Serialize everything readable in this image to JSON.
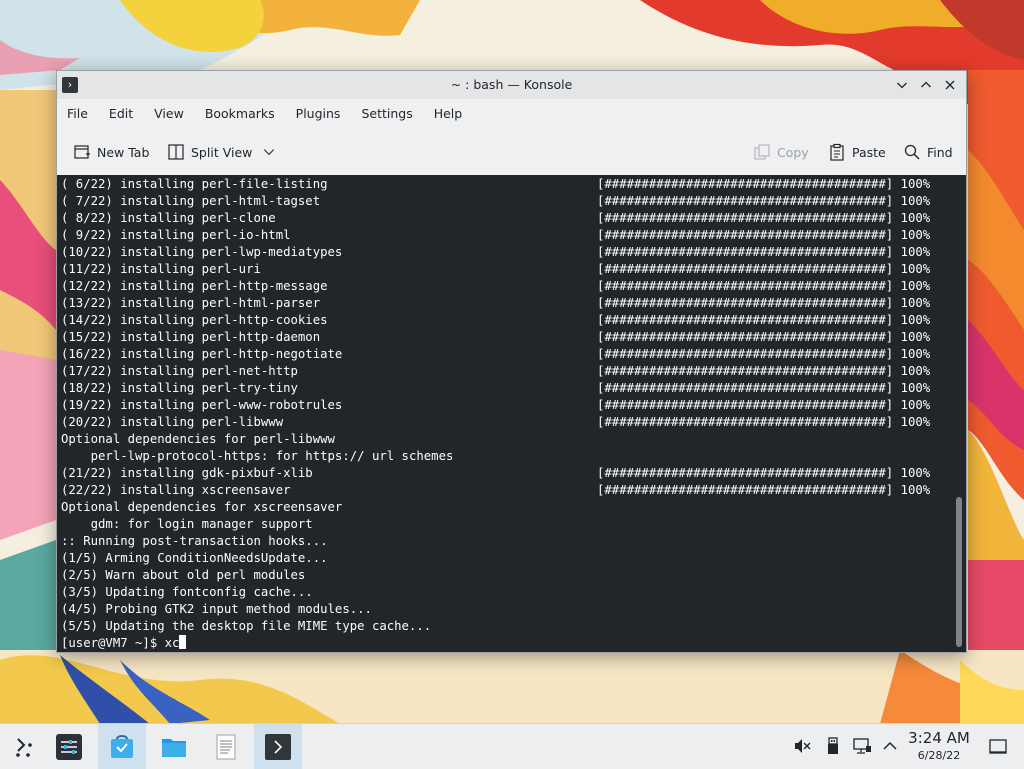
{
  "window": {
    "title": "~ : bash — Konsole",
    "menu": [
      "File",
      "Edit",
      "View",
      "Bookmarks",
      "Plugins",
      "Settings",
      "Help"
    ],
    "toolbar": {
      "new_tab": "New Tab",
      "split_view": "Split View",
      "copy": "Copy",
      "paste": "Paste",
      "find": "Find"
    }
  },
  "terminal": {
    "lines": [
      {
        "text": "( 6/22) installing perl-file-listing",
        "progress": "[######################################] 100%"
      },
      {
        "text": "( 7/22) installing perl-html-tagset",
        "progress": "[######################################] 100%"
      },
      {
        "text": "( 8/22) installing perl-clone",
        "progress": "[######################################] 100%"
      },
      {
        "text": "( 9/22) installing perl-io-html",
        "progress": "[######################################] 100%"
      },
      {
        "text": "(10/22) installing perl-lwp-mediatypes",
        "progress": "[######################################] 100%"
      },
      {
        "text": "(11/22) installing perl-uri",
        "progress": "[######################################] 100%"
      },
      {
        "text": "(12/22) installing perl-http-message",
        "progress": "[######################################] 100%"
      },
      {
        "text": "(13/22) installing perl-html-parser",
        "progress": "[######################################] 100%"
      },
      {
        "text": "(14/22) installing perl-http-cookies",
        "progress": "[######################################] 100%"
      },
      {
        "text": "(15/22) installing perl-http-daemon",
        "progress": "[######################################] 100%"
      },
      {
        "text": "(16/22) installing perl-http-negotiate",
        "progress": "[######################################] 100%"
      },
      {
        "text": "(17/22) installing perl-net-http",
        "progress": "[######################################] 100%"
      },
      {
        "text": "(18/22) installing perl-try-tiny",
        "progress": "[######################################] 100%"
      },
      {
        "text": "(19/22) installing perl-www-robotrules",
        "progress": "[######################################] 100%"
      },
      {
        "text": "(20/22) installing perl-libwww",
        "progress": "[######################################] 100%"
      },
      {
        "text": "Optional dependencies for perl-libwww"
      },
      {
        "text": "    perl-lwp-protocol-https: for https:// url schemes"
      },
      {
        "text": "(21/22) installing gdk-pixbuf-xlib",
        "progress": "[######################################] 100%"
      },
      {
        "text": "(22/22) installing xscreensaver",
        "progress": "[######################################] 100%"
      },
      {
        "text": "Optional dependencies for xscreensaver"
      },
      {
        "text": "    gdm: for login manager support"
      },
      {
        "text": ":: Running post-transaction hooks..."
      },
      {
        "text": "(1/5) Arming ConditionNeedsUpdate..."
      },
      {
        "text": "(2/5) Warn about old perl modules"
      },
      {
        "text": "(3/5) Updating fontconfig cache..."
      },
      {
        "text": "(4/5) Probing GTK2 input method modules..."
      },
      {
        "text": "(5/5) Updating the desktop file MIME type cache..."
      }
    ],
    "prompt": "[user@VM7 ~]$ ",
    "command": "xc"
  },
  "taskbar": {
    "items": [
      {
        "name": "application-launcher",
        "icon": "launcher-icon"
      },
      {
        "name": "system-settings",
        "icon": "settings-sliders-icon"
      },
      {
        "name": "discover",
        "icon": "discover-store-icon"
      },
      {
        "name": "dolphin",
        "icon": "folder-icon"
      },
      {
        "name": "text-editor",
        "icon": "document-icon"
      },
      {
        "name": "konsole",
        "icon": "terminal-icon"
      }
    ],
    "tray": [
      "volume-muted-icon",
      "usb-icon",
      "network-wired-icon",
      "tray-expand-icon"
    ],
    "clock": {
      "time": "3:24 AM",
      "date": "6/28/22"
    },
    "show_desktop": "show-desktop-icon"
  },
  "colors": {
    "terminal_bg": "#232629",
    "terminal_fg": "#fcfcfc",
    "window_bg": "#eff0f1",
    "accent": "#3daee9"
  }
}
